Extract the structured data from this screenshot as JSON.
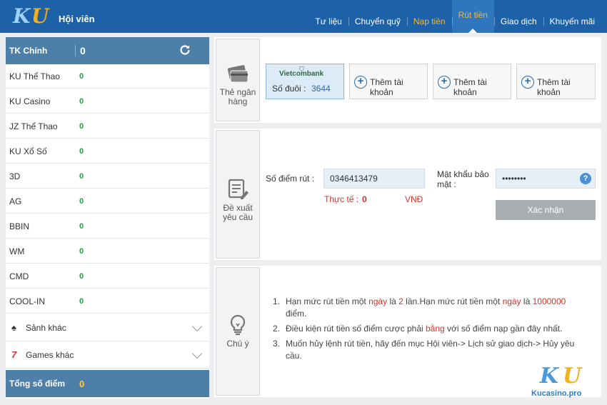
{
  "header": {
    "logo_k": "K",
    "logo_u": "U",
    "title": "Hội viên",
    "nav": [
      {
        "label": "Tư liệu",
        "style": "normal"
      },
      {
        "label": "Chuyển quỹ",
        "style": "normal"
      },
      {
        "label": "Nạp tiền",
        "style": "orange"
      },
      {
        "label": "Rút tiền",
        "style": "active"
      },
      {
        "label": "Giao dịch",
        "style": "normal"
      },
      {
        "label": "Khuyến mãi",
        "style": "normal"
      }
    ]
  },
  "sidebar": {
    "main": {
      "label": "TK Chính",
      "value": "0",
      "icon": "refresh-icon"
    },
    "items": [
      {
        "label": "KU Thể Thao",
        "value": "0"
      },
      {
        "label": "KU Casino",
        "value": "0"
      },
      {
        "label": "JZ Thể Thao",
        "value": "0"
      },
      {
        "label": "KU Xổ Số",
        "value": "0"
      },
      {
        "label": "3D",
        "value": "0"
      },
      {
        "label": "AG",
        "value": "0"
      },
      {
        "label": "BBIN",
        "value": "0"
      },
      {
        "label": "WM",
        "value": "0"
      },
      {
        "label": "CMD",
        "value": "0"
      },
      {
        "label": "COOL-IN",
        "value": "0"
      }
    ],
    "groups": [
      {
        "label": "Sảnh khác",
        "icon": "spade-icon",
        "glyph": "♠"
      },
      {
        "label": "Games khác",
        "icon": "seven-icon",
        "glyph": "7"
      }
    ],
    "total": {
      "label": "Tổng số điểm",
      "value": "0"
    }
  },
  "bank_panel": {
    "label": "Thẻ ngân hàng",
    "selected_card": {
      "bank": "Vietcombank",
      "tail_label": "Số đuôi :",
      "tail_value": "3644"
    },
    "add_buttons": [
      "Thêm tài khoản",
      "Thêm tài khoản",
      "Thêm tài khoản"
    ]
  },
  "request_panel": {
    "label": "Đề xuất yêu cầu",
    "points_label": "Số điểm rút :",
    "points_value": "0346413479",
    "actual_label": "Thực tế :",
    "actual_value": "0",
    "currency": "VNĐ",
    "password_label": "Mật khẩu bảo mật :",
    "password_value": "••••••••",
    "help_glyph": "?",
    "confirm_label": "Xác nhận"
  },
  "notes_panel": {
    "label": "Chú ý",
    "notes": [
      {
        "num": "1.",
        "parts": [
          "Hạn mức rút tiền một ",
          "ngày",
          " là ",
          "2",
          " lần.Hạn mức rút tiền một ",
          "ngày",
          " là ",
          "1000000",
          " điểm."
        ]
      },
      {
        "num": "2.",
        "parts": [
          "Điều kiện rút tiền số điểm cược phải ",
          "bằng",
          " với số điểm nạp gần đây nhất."
        ]
      },
      {
        "num": "3.",
        "parts": [
          "Muốn hủy lệnh rút tiền, hãy đến mục Hội viên-> Lịch sử giao dịch-> Hủy yêu cầu."
        ]
      }
    ]
  },
  "watermark": {
    "k": "K",
    "u": "U",
    "site": "Kucasino.pro"
  },
  "colors": {
    "header_bg": "#1d62a8",
    "accent_orange": "#f5b63a",
    "sidebar_highlight": "#4e7fa9",
    "value_green": "#25a244",
    "warning_red": "#d0342c"
  }
}
